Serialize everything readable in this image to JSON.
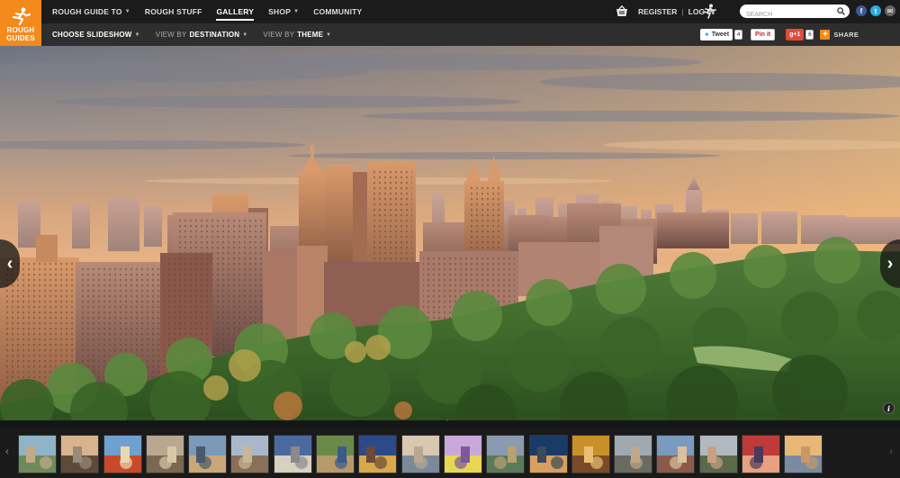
{
  "brand": {
    "logo_line1": "ROUGH",
    "logo_line2": "GUIDES",
    "accent": "#f28a1c"
  },
  "nav": {
    "items": [
      {
        "label": "ROUGH GUIDE TO",
        "has_caret": true
      },
      {
        "label": "ROUGH STUFF",
        "has_caret": false
      },
      {
        "label": "GALLERY",
        "has_caret": false,
        "active": true
      },
      {
        "label": "SHOP",
        "has_caret": true
      },
      {
        "label": "COMMUNITY",
        "has_caret": false
      }
    ]
  },
  "account": {
    "register": "REGISTER",
    "login": "LOG IN",
    "separator": "|"
  },
  "search": {
    "placeholder": "SEARCH"
  },
  "social": [
    {
      "name": "facebook-icon",
      "glyph": "f",
      "color": "#3b5998"
    },
    {
      "name": "twitter-icon",
      "glyph": "t",
      "color": "#2aa9e0"
    },
    {
      "name": "email-icon",
      "glyph": "✉",
      "color": "#666666"
    }
  ],
  "subnav": {
    "choose": "CHOOSE SLIDESHOW",
    "view_by": "VIEW BY",
    "destination": "DESTINATION",
    "theme": "THEME"
  },
  "sharing": {
    "tweet": "Tweet",
    "tweet_count": "4",
    "pinit": "Pin it",
    "gplus": "g+1",
    "gplus_count": "6",
    "share": "SHARE"
  },
  "gallery": {
    "prev": "‹",
    "next": "›",
    "info": "i",
    "handle": "ˇ",
    "thumb_count": 19
  }
}
